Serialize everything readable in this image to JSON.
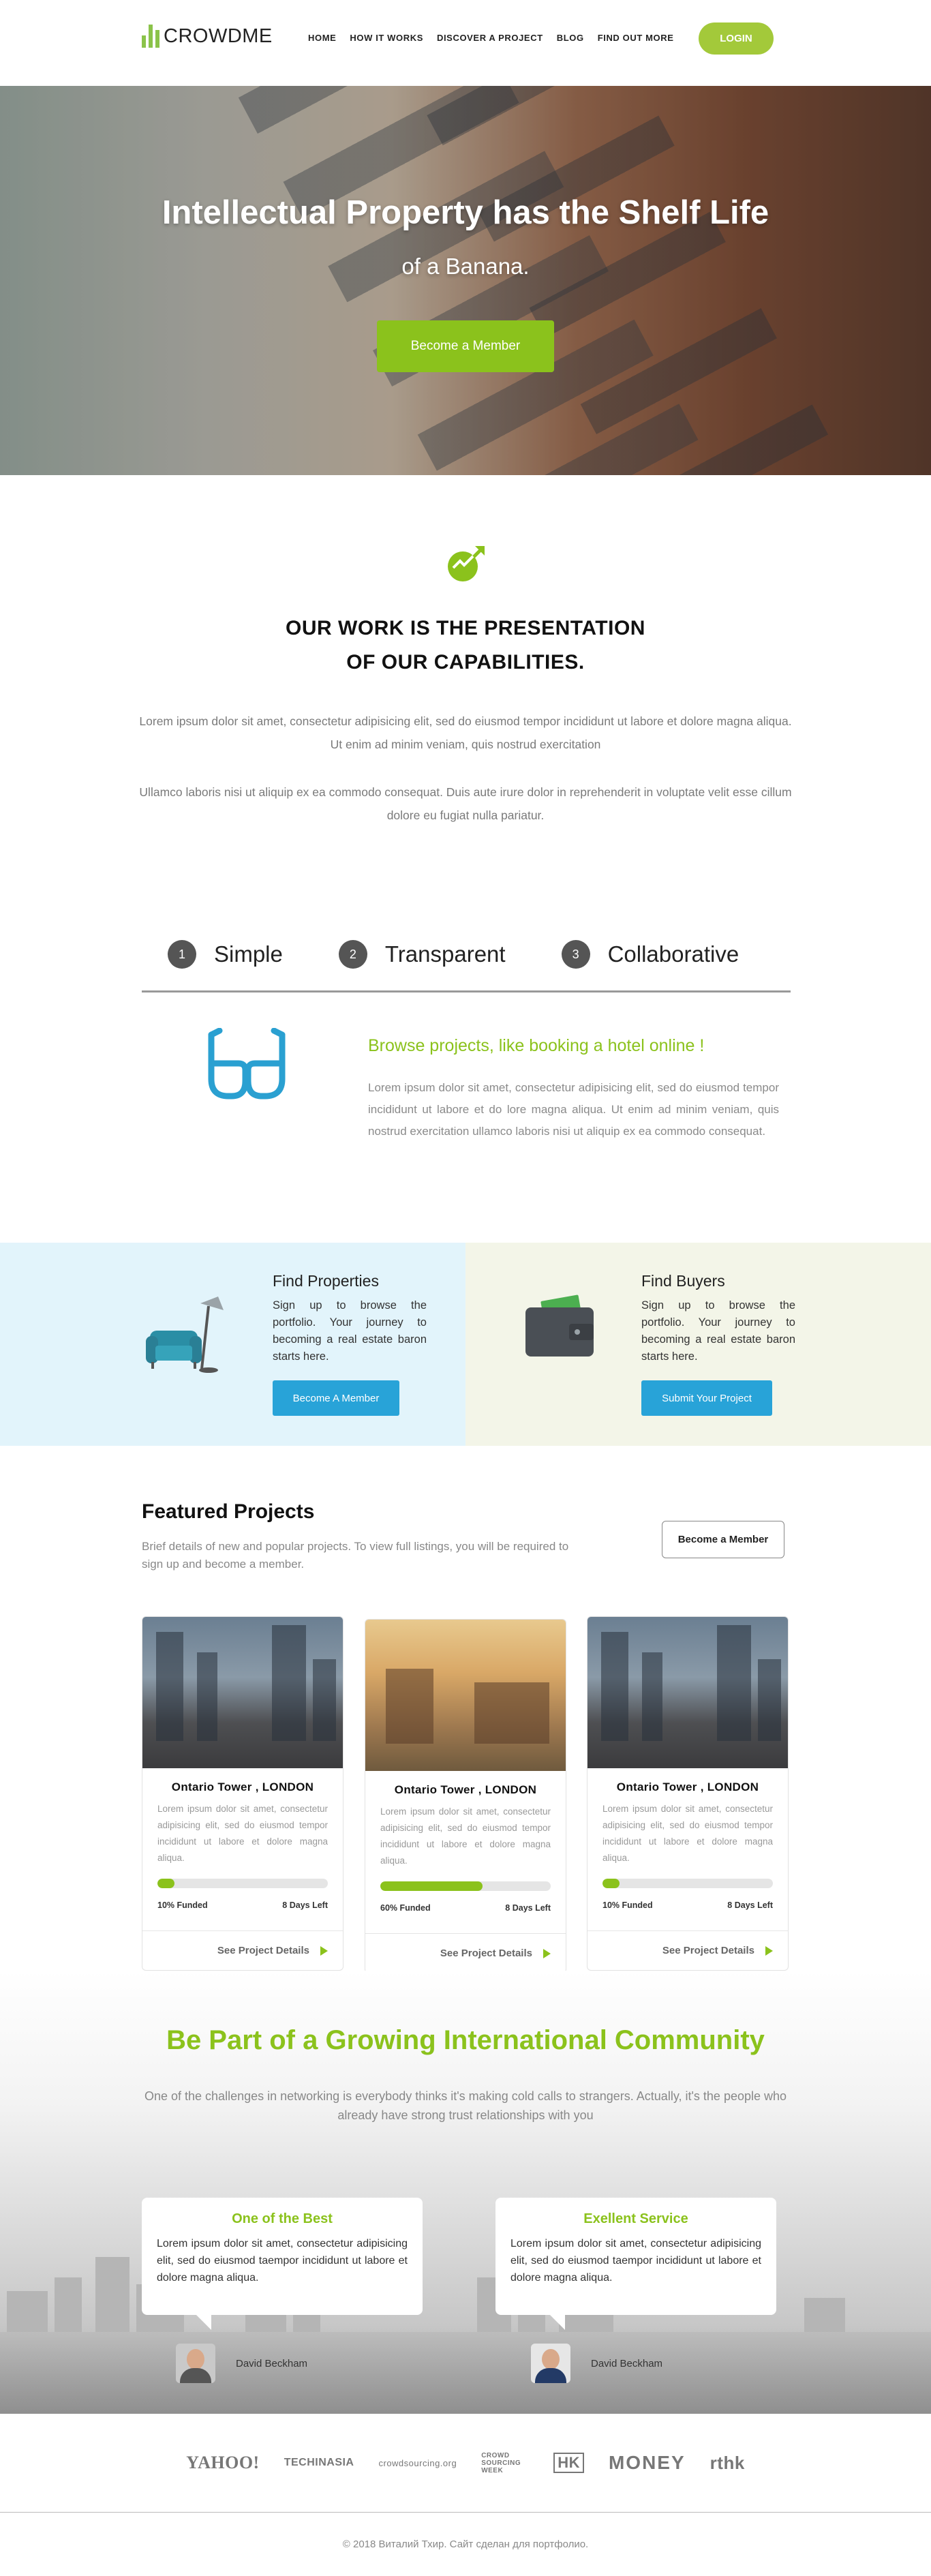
{
  "nav": {
    "logo": "CROWDME",
    "items": [
      "HOME",
      "HOW IT WORKS",
      "DISCOVER A PROJECT",
      "BLOG",
      "FIND OUT MORE"
    ],
    "login": "LOGIN"
  },
  "hero": {
    "title": "Intellectual Property has the Shelf Life",
    "subtitle": "of a Banana.",
    "button": "Become a Member"
  },
  "work": {
    "title_line1": "OUR WORK IS THE PRESENTATION",
    "title_line2": "OF OUR CAPABILITIES.",
    "p1": "Lorem ipsum dolor sit amet, consectetur adipisicing elit, sed do eiusmod tempor incididunt ut labore et dolore magna aliqua. Ut enim ad minim veniam, quis nostrud exercitation",
    "p2": "Ullamco laboris nisi ut aliquip ex ea commodo consequat. Duis aute irure dolor in reprehenderit in voluptate velit esse cillum dolore eu fugiat nulla pariatur."
  },
  "steps": [
    {
      "num": "1",
      "label": "Simple"
    },
    {
      "num": "2",
      "label": "Transparent"
    },
    {
      "num": "3",
      "label": "Collaborative"
    }
  ],
  "feature": {
    "heading": "Browse projects, like booking a hotel online !",
    "text": "Lorem ipsum dolor sit amet, consectetur adipisicing elit, sed do eiusmod tempor incididunt ut labore et do lore magna aliqua. Ut enim ad minim veniam, quis nostrud exercitation ullamco laboris nisi ut aliquip ex ea commodo consequat."
  },
  "find": [
    {
      "title": "Find Properties",
      "text": "Sign up to browse the portfolio. Your journey to becoming a real estate baron starts here.",
      "button": "Become A Member"
    },
    {
      "title": "Find Buyers",
      "text": "Sign up to browse the portfolio. Your journey to becoming a real estate baron starts here.",
      "button": "Submit Your Project"
    }
  ],
  "featured": {
    "title": "Featured Projects",
    "desc": "Brief details of new and popular projects. To view full listings, you will be required to sign up and become a member.",
    "button": "Become a Member",
    "cards": [
      {
        "name": "Ontario Tower , LONDON",
        "text": "Lorem ipsum dolor sit amet, consectetur adipisicing elit, sed do eiusmod tempor incididunt ut labore et dolore magna aliqua.",
        "funded": "10% Funded",
        "progress": 0.1,
        "days": "8 Days Left",
        "link": "See Project Details"
      },
      {
        "name": "Ontario Tower , LONDON",
        "text": "Lorem ipsum dolor sit amet, consectetur adipisicing elit, sed do eiusmod tempor incididunt ut labore et dolore magna aliqua.",
        "funded": "60% Funded",
        "progress": 0.6,
        "days": "8 Days Left",
        "link": "See Project Details"
      },
      {
        "name": "Ontario Tower , LONDON",
        "text": "Lorem ipsum dolor sit amet, consectetur adipisicing elit, sed do eiusmod tempor incididunt ut labore et dolore magna aliqua.",
        "funded": "10% Funded",
        "progress": 0.1,
        "days": "8 Days Left",
        "link": "See Project Details"
      }
    ]
  },
  "community": {
    "title": "Be Part of a Growing International Community",
    "text": "One of the challenges in networking is everybody thinks it's making cold calls to strangers. Actually, it's the people who already have strong trust relationships with you",
    "testimonials": [
      {
        "title": "One of the Best",
        "text": "Lorem ipsum dolor sit amet, consectetur adipisicing elit, sed do eiusmod taempor incididunt ut labore et dolore magna aliqua.",
        "author": "David Beckham"
      },
      {
        "title": "Exellent Service",
        "text": "Lorem ipsum dolor sit amet, consectetur adipisicing elit, sed do eiusmod taempor incididunt ut labore et dolore magna aliqua.",
        "author": "David Beckham"
      }
    ]
  },
  "partners": [
    "YAHOO!",
    "TECHINASIA",
    "crowdsourcing.org",
    "CROWD SOURCING WEEK",
    "HK",
    "MONEY",
    "rthk"
  ],
  "footer": "© 2018 Виталий Тхир. Сайт сделан для портфолио.",
  "colors": {
    "accent": "#8bc21c",
    "blue": "#28a3d8"
  }
}
